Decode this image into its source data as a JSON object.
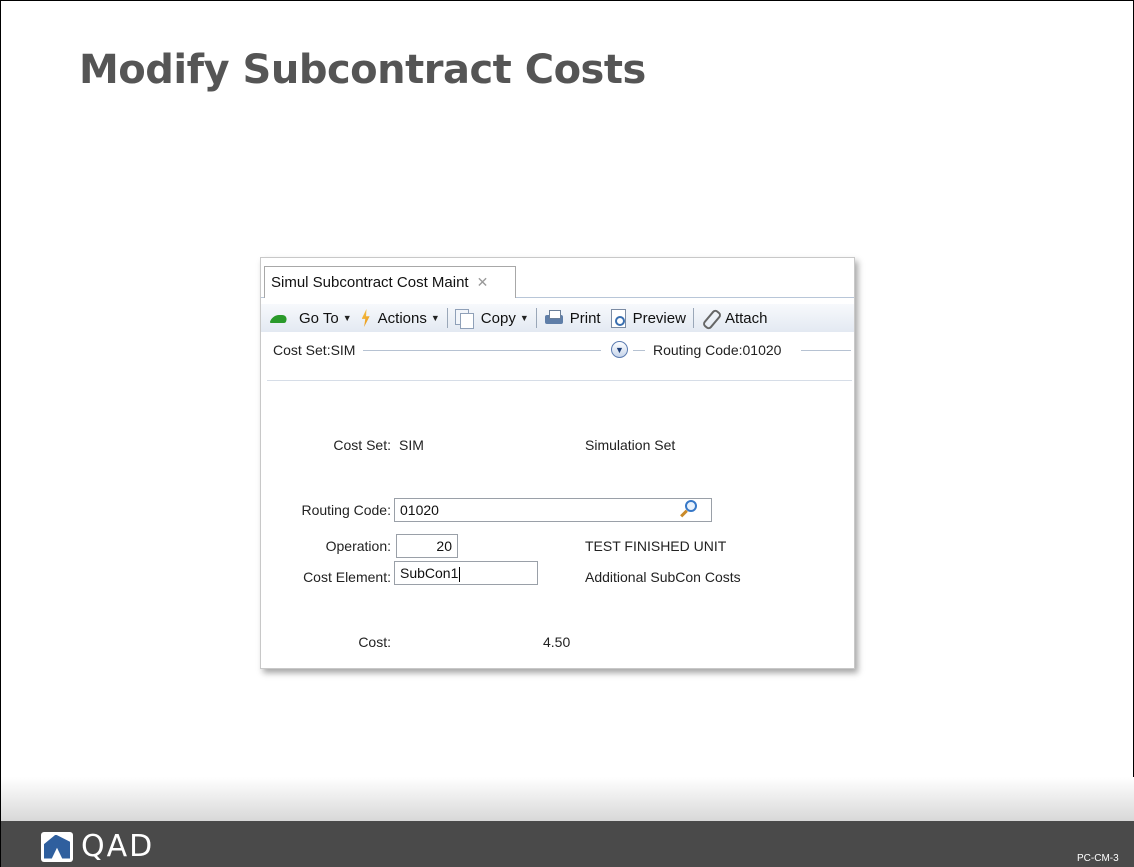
{
  "slide": {
    "title": "Modify Subcontract Costs",
    "page_code": "PC-CM-3",
    "logo_text": "QAD"
  },
  "window": {
    "tab_label": "Simul Subcontract Cost Maint",
    "tab_close": "✕",
    "toolbar": {
      "goto": "Go To",
      "actions": "Actions",
      "copy": "Copy",
      "print": "Print",
      "preview": "Preview",
      "attach": "Attach"
    },
    "header": {
      "cost_set": "Cost Set:SIM",
      "routing_code": "Routing Code:01020"
    },
    "form": {
      "cost_set_label": "Cost Set:",
      "cost_set_value": "SIM",
      "cost_set_desc": "Simulation Set",
      "routing_code_label": "Routing Code:",
      "routing_code_value": "01020",
      "operation_label": "Operation:",
      "operation_value": "20",
      "operation_desc": "TEST FINISHED UNIT",
      "cost_element_label": "Cost Element:",
      "cost_element_value": "SubCon1",
      "cost_element_desc": "Additional SubCon Costs",
      "cost_label": "Cost:",
      "cost_value": "4.50"
    }
  },
  "icons": {
    "goto": "arrow-icon",
    "actions": "lightning-icon",
    "copy": "copy-icon",
    "print": "printer-icon",
    "preview": "preview-icon",
    "attach": "paperclip-icon",
    "expand": "chevron-down-icon",
    "lookup": "magnifier-icon"
  }
}
